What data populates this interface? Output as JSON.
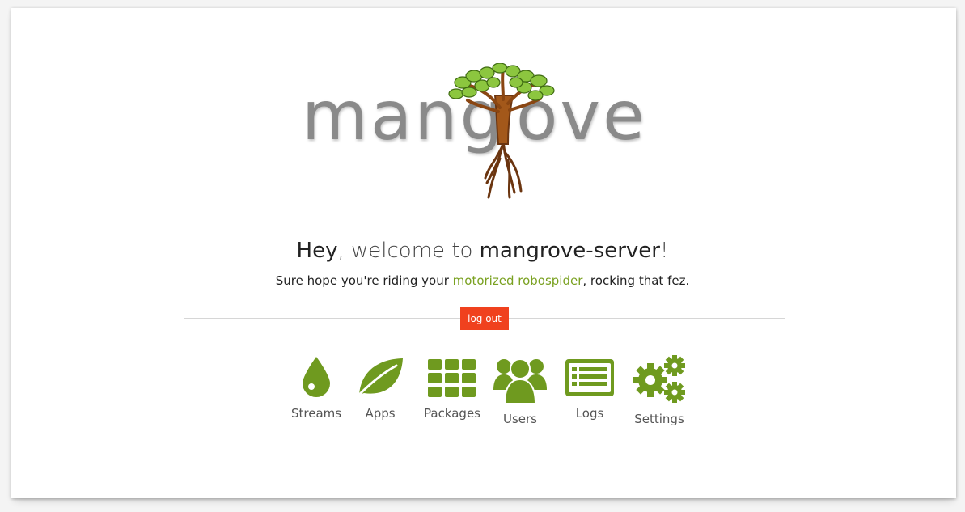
{
  "logo": {
    "left_text": "mang",
    "right_text": "ove",
    "tree_icon": "mangrove-tree-icon"
  },
  "welcome": {
    "hey": "Hey",
    "middle": ", welcome to ",
    "server": "mangrove-server",
    "end": "!"
  },
  "subtitle": {
    "before": "Sure hope you're riding your ",
    "link": "motorized robospider",
    "after": ", rocking that fez."
  },
  "logout_label": "log out",
  "nav": [
    {
      "label": "Streams",
      "icon": "drop-icon"
    },
    {
      "label": "Apps",
      "icon": "leaf-icon"
    },
    {
      "label": "Packages",
      "icon": "grid-icon"
    },
    {
      "label": "Users",
      "icon": "users-icon"
    },
    {
      "label": "Logs",
      "icon": "list-icon"
    },
    {
      "label": "Settings",
      "icon": "gears-icon"
    }
  ],
  "colors": {
    "accent_green": "#6f9a1f",
    "link_green": "#7aa121",
    "logout_red": "#f0411e"
  }
}
